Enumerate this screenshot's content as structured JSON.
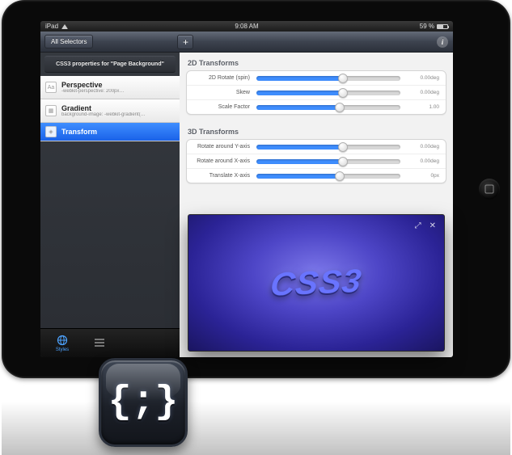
{
  "status": {
    "carrier": "iPad",
    "time": "9:08 AM",
    "battery_pct": "59 %"
  },
  "nav": {
    "back_label": "All Selectors",
    "add_glyph": "+",
    "info_glyph": "i"
  },
  "sidebar": {
    "header": "CSS3 properties for \"Page Background\"",
    "items": [
      {
        "icon": "Aa",
        "title": "Perspective",
        "sub": "-webkit-perspective: 200px…",
        "selected": false
      },
      {
        "icon": "▦",
        "title": "Gradient",
        "sub": "background-image: -webkit-gradient(…",
        "selected": false
      },
      {
        "icon": "◈",
        "title": "Transform",
        "sub": "",
        "selected": true
      }
    ],
    "tabs": [
      {
        "label": "Styles",
        "active": true
      },
      {
        "label": "",
        "active": false
      }
    ]
  },
  "panel": {
    "sections": [
      {
        "title": "2D Transforms",
        "rows": [
          {
            "label": "2D Rotate (spin)",
            "value": "0.00deg",
            "pct": 60
          },
          {
            "label": "Skew",
            "value": "0.00deg",
            "pct": 60
          },
          {
            "label": "Scale Factor",
            "value": "1.00",
            "pct": 58
          }
        ]
      },
      {
        "title": "3D Transforms",
        "rows": [
          {
            "label": "Rotate around Y-axis",
            "value": "0.00deg",
            "pct": 60
          },
          {
            "label": "Rotate around X-axis",
            "value": "0.00deg",
            "pct": 60
          },
          {
            "label": "Translate X-axis",
            "value": "0px",
            "pct": 58
          }
        ]
      }
    ]
  },
  "preview": {
    "text": "CSS3",
    "expand_glyph": "⤢",
    "close_glyph": "✕"
  },
  "app_icon": {
    "glyph": "{;}"
  }
}
